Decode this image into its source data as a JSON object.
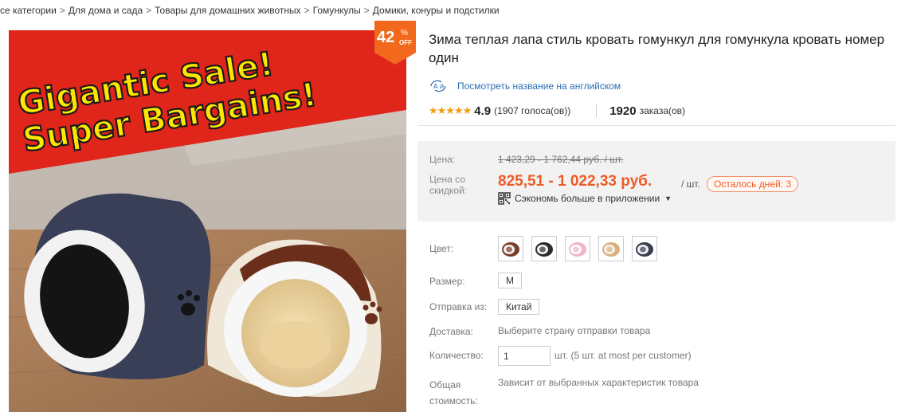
{
  "breadcrumb": [
    "се категории",
    "Для дома и сада",
    "Товары для домашних животных",
    "Гомункулы",
    "Домики, конуры и подстилки"
  ],
  "breadcrumb_separator": ">",
  "gallery": {
    "banner_line1": "Gigantic Sale!",
    "banner_line2": "Super Bargains!",
    "banner_bg": "#e0251b",
    "banner_text": "#ffe600"
  },
  "discount": {
    "percent": "42",
    "percent_sign": "%",
    "off": "OFF",
    "color": "#f2691e"
  },
  "product": {
    "title": "Зима теплая лапа стиль кровать гомункул для гомункула кровать номер один",
    "translate_link": "Посмотреть название на английском",
    "stars": "★★★★★",
    "rating": "4.9",
    "votes": "(1907 голоса(ов))",
    "orders_count": "1920",
    "orders_label": "заказа(ов)"
  },
  "price": {
    "label": "Цена:",
    "old": "1 423,29 - 1 762,44 руб. / шт.",
    "discount_label": "Цена со скидкой:",
    "new": "825,51 - 1 022,33 руб.",
    "per_unit": "/ шт.",
    "days_left": "Осталось дней: 3",
    "app_save": "Сэкономь больше в приложении",
    "accent": "#ef5b25"
  },
  "options": {
    "color_label": "Цвет:",
    "colors": [
      "#7a3d28",
      "#2b2b2b",
      "#f0b6c8",
      "#d9b07a",
      "#3a3f52"
    ],
    "size_label": "Размер:",
    "size_value": "M",
    "ship_from_label": "Отправка из:",
    "ship_from_value": "Китай",
    "delivery_label": "Доставка:",
    "delivery_value": "Выберите страну отправки товара",
    "qty_label": "Количество:",
    "qty_value": "1",
    "qty_note": "шт. (5 шт. at most per customer)",
    "total_label": "Общая стоимость:",
    "total_value": "Зависит от выбранных характеристик товара"
  }
}
